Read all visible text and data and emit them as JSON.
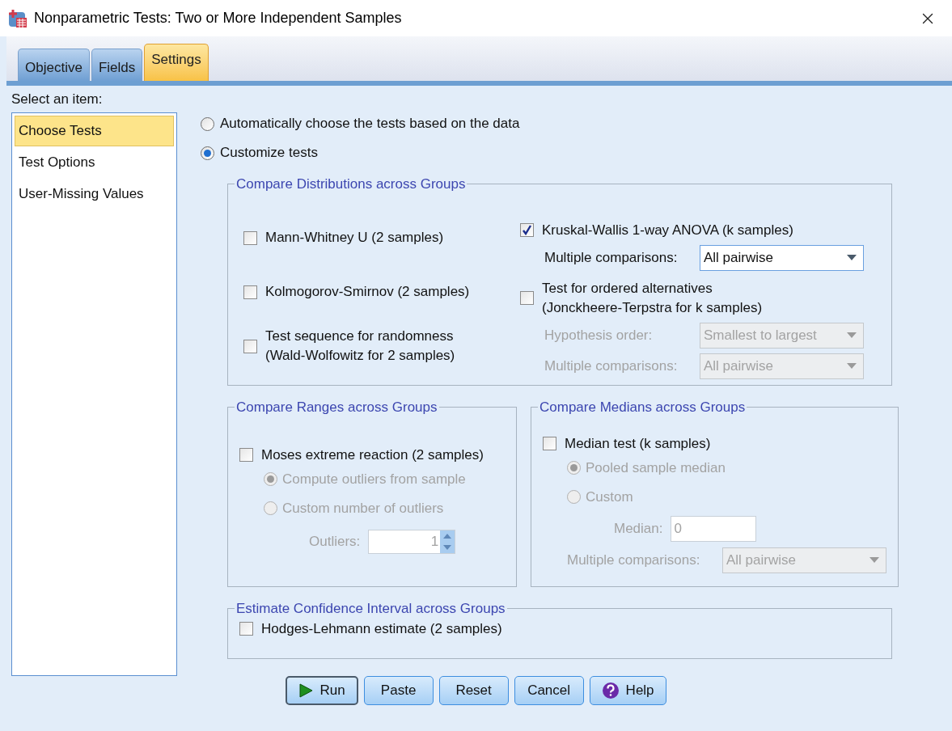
{
  "window": {
    "title": "Nonparametric Tests: Two or More Independent Samples"
  },
  "tabs": [
    {
      "label": "Objective",
      "selected": false
    },
    {
      "label": "Fields",
      "selected": false
    },
    {
      "label": "Settings",
      "selected": true
    }
  ],
  "sidebar": {
    "label": "Select an item:",
    "items": [
      {
        "label": "Choose Tests",
        "selected": true
      },
      {
        "label": "Test Options",
        "selected": false
      },
      {
        "label": "User-Missing Values",
        "selected": false
      }
    ]
  },
  "mode_options": [
    {
      "label": "Automatically choose the tests based on the data",
      "selected": false
    },
    {
      "label": "Customize tests",
      "selected": true
    }
  ],
  "distributions": {
    "title": "Compare Distributions across Groups",
    "left": [
      {
        "kind": "checkbox",
        "label": "Mann-Whitney U (2 samples)",
        "checked": false,
        "disabled": false
      },
      {
        "kind": "checkbox",
        "label": "Kolmogorov-Smirnov (2 samples)",
        "checked": false,
        "disabled": false
      },
      {
        "kind": "checkbox",
        "label": "Test sequence for randomness\n(Wald-Wolfowitz for 2 samples)",
        "checked": false,
        "disabled": false
      }
    ],
    "right": [
      {
        "kind": "checkbox",
        "label": "Kruskal-Wallis 1-way ANOVA (k samples)",
        "checked": true,
        "disabled": false,
        "children": [
          {
            "kind": "dropdown",
            "label": "Multiple comparisons:",
            "value": "All pairwise",
            "disabled": false
          }
        ]
      },
      {
        "kind": "checkbox",
        "label": "Test for ordered alternatives\n(Jonckheere-Terpstra for k samples)",
        "checked": false,
        "disabled": false,
        "children": [
          {
            "kind": "dropdown",
            "label": "Hypothesis order:",
            "value": "Smallest to largest",
            "disabled": true
          },
          {
            "kind": "dropdown",
            "label": "Multiple comparisons:",
            "value": "All pairwise",
            "disabled": true
          }
        ]
      }
    ]
  },
  "ranges": {
    "title": "Compare Ranges across Groups",
    "items": [
      {
        "kind": "checkbox",
        "label": "Moses extreme reaction (2 samples)",
        "checked": false,
        "disabled": false,
        "children": [
          {
            "kind": "radio",
            "label": "Compute outliers from sample",
            "selected": true,
            "disabled": true
          },
          {
            "kind": "radio",
            "label": "Custom number of outliers",
            "selected": false,
            "disabled": true,
            "children": [
              {
                "kind": "spinner",
                "label": "Outliers:",
                "value": "1",
                "disabled": true
              }
            ]
          }
        ]
      }
    ]
  },
  "medians": {
    "title": "Compare Medians across Groups",
    "items": [
      {
        "kind": "checkbox",
        "label": "Median test (k samples)",
        "checked": false,
        "disabled": false,
        "children": [
          {
            "kind": "radio",
            "label": "Pooled sample median",
            "selected": true,
            "disabled": true
          },
          {
            "kind": "radio",
            "label": "Custom",
            "selected": false,
            "disabled": true,
            "children": [
              {
                "kind": "text_field",
                "label": "Median:",
                "value": "0",
                "disabled": true
              }
            ]
          },
          {
            "kind": "dropdown",
            "label": "Multiple comparisons:",
            "value": "All pairwise",
            "disabled": true
          }
        ]
      }
    ]
  },
  "confidence": {
    "title": "Estimate Confidence Interval across Groups",
    "items": [
      {
        "kind": "checkbox",
        "label": "Hodges-Lehmann estimate (2 samples)",
        "checked": false,
        "disabled": false
      }
    ]
  },
  "buttons": [
    {
      "kind": "run",
      "label": "Run"
    },
    {
      "kind": "plain",
      "label": "Paste"
    },
    {
      "kind": "plain",
      "label": "Reset"
    },
    {
      "kind": "plain",
      "label": "Cancel"
    },
    {
      "kind": "help",
      "label": "Help"
    }
  ]
}
